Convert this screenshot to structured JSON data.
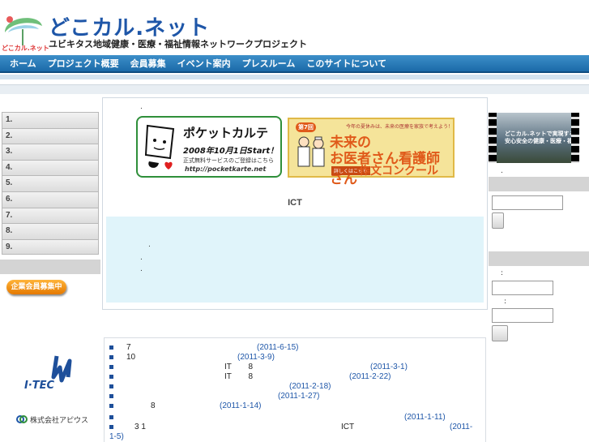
{
  "header": {
    "title": "どこカル.ネット",
    "subtitle": "ユビキタス地域健康・医療・福祉情報ネットワークプロジェクト",
    "logo_small_text": "どこカル.ネット"
  },
  "nav": [
    "ホーム",
    "プロジェクト概要",
    "会員募集",
    "イベント案内",
    "プレスルーム",
    "このサイトについて"
  ],
  "left_menu": [
    "1.",
    "2.",
    "3.",
    "4.",
    "5.",
    "6.",
    "7.",
    "8.",
    "9."
  ],
  "corporate_button": "企業会員募集中",
  "sponsors": {
    "itec": "I·TEC",
    "apios": "株式会社アピウス"
  },
  "center": {
    "dot": ".",
    "pocket_banner": {
      "title": "ポケットカルテ",
      "date": "2008年10月1日Start！",
      "note": "正式無料サービスのご登録はこちら",
      "url": "http://pocketkarte.net"
    },
    "contest_banner": {
      "line1": "今年の夏休みは、未来の医療を家族で考えよう！",
      "badge": "第7回",
      "line2": "未来の",
      "line3": "お医者さん看護師さん",
      "line4": "作文コンクール",
      "small": "詳しくはこちら"
    },
    "heading": "ICT",
    "cyan_dots": [
      ".",
      ".",
      "."
    ]
  },
  "right": {
    "video_caption": "どこカル.ネットで実現する安心安全の健康・医療・福祉",
    "dot": ".",
    "colon1": ":",
    "colon2": ":"
  },
  "news": [
    {
      "prefix": "7",
      "mid": "",
      "date": "(2011-6-15)"
    },
    {
      "prefix": "10",
      "mid": "",
      "date": "(2011-3-9)"
    },
    {
      "prefix": "",
      "mid": "IT 8",
      "date": "(2011-3-1)"
    },
    {
      "prefix": "",
      "mid": "IT 8",
      "date": "(2011-2-22)"
    },
    {
      "prefix": "",
      "mid": "",
      "date": "(2011-2-18)"
    },
    {
      "prefix": "",
      "mid": "",
      "date": "(2011-1-27)"
    },
    {
      "prefix": "8",
      "mid": "",
      "date": "(2011-1-14)"
    },
    {
      "prefix": "",
      "mid": "",
      "date": "(2011-1-11)"
    },
    {
      "prefix": "3 1",
      "mid": "ICT",
      "date": "(2011-"
    },
    {
      "prefix": "",
      "mid": "",
      "date": "1-5)"
    }
  ],
  "colors": {
    "brand_blue": "#1e56a8",
    "nav_blue": "#1b6aa8",
    "accent_orange": "#e57900"
  }
}
